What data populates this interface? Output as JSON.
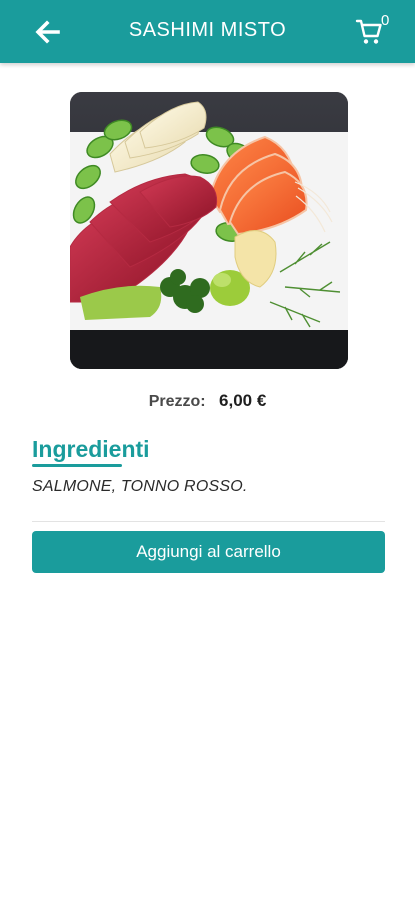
{
  "header": {
    "title": "SASHIMI MISTO",
    "back_icon": "arrow-left-icon",
    "cart_icon": "shopping-cart-icon",
    "cart_count": "0",
    "color": "#1a9c9c"
  },
  "product": {
    "image_icon": "sashimi-photo",
    "price_label": "Prezzo:",
    "price_value": "6,00 €"
  },
  "ingredients": {
    "title": "Ingredienti",
    "text": "SALMONE, TONNO ROSSO."
  },
  "actions": {
    "add_to_cart": "Aggiungi al carrello"
  }
}
